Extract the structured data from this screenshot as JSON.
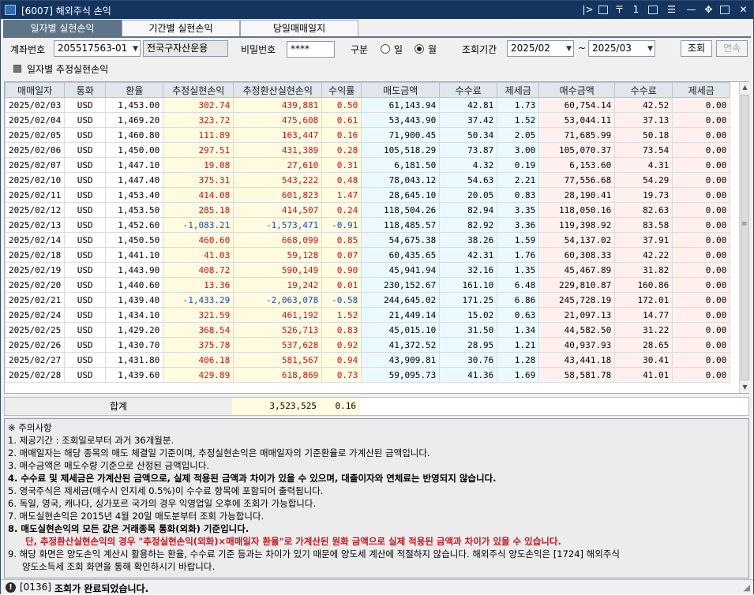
{
  "window": {
    "title": "[6007] 해외주식 손익"
  },
  "tabs": [
    {
      "label": "일자별 실현손익",
      "active": true
    },
    {
      "label": "기간별 실현손익",
      "active": false
    },
    {
      "label": "당일매매일지",
      "active": false
    }
  ],
  "form": {
    "account_label": "계좌번호",
    "account_value": "205517563-01",
    "account_type": "전국구자산운용",
    "password_label": "비밀번호",
    "password_value": "****",
    "division_label": "구분",
    "division_options": [
      "일",
      "월"
    ],
    "division_selected": "월",
    "period_label": "조회기간",
    "period_from": "2025/02",
    "period_sep": "~",
    "period_to": "2025/03",
    "search_button": "조회",
    "continue_button": "연속",
    "estimate_checkbox_label": "일자별 추정실현손익"
  },
  "table": {
    "columns": [
      "매매일자",
      "통화",
      "환율",
      "추정실현손익",
      "추정환산실현손익",
      "수익률",
      "매도금액",
      "수수료",
      "제세금",
      "매수금액",
      "수수료",
      "제세금"
    ],
    "rows": [
      [
        "2025/02/03",
        "USD",
        "1,453.00",
        "302.74",
        "439,881",
        "0.50",
        "61,143.94",
        "42.81",
        "1.73",
        "60,754.14",
        "42.52",
        "0.00"
      ],
      [
        "2025/02/04",
        "USD",
        "1,469.20",
        "323.72",
        "475,608",
        "0.61",
        "53,443.90",
        "37.42",
        "1.52",
        "53,044.11",
        "37.13",
        "0.00"
      ],
      [
        "2025/02/05",
        "USD",
        "1,460.80",
        "111.89",
        "163,447",
        "0.16",
        "71,900.45",
        "50.34",
        "2.05",
        "71,685.99",
        "50.18",
        "0.00"
      ],
      [
        "2025/02/06",
        "USD",
        "1,450.00",
        "297.51",
        "431,389",
        "0.28",
        "105,518.29",
        "73.87",
        "3.00",
        "105,070.37",
        "73.54",
        "0.00"
      ],
      [
        "2025/02/07",
        "USD",
        "1,447.10",
        "19.08",
        "27,610",
        "0.31",
        "6,181.50",
        "4.32",
        "0.19",
        "6,153.60",
        "4.31",
        "0.00"
      ],
      [
        "2025/02/10",
        "USD",
        "1,447.40",
        "375.31",
        "543,222",
        "0.48",
        "78,043.12",
        "54.63",
        "2.21",
        "77,556.68",
        "54.29",
        "0.00"
      ],
      [
        "2025/02/11",
        "USD",
        "1,453.40",
        "414.08",
        "601,823",
        "1.47",
        "28,645.10",
        "20.05",
        "0.83",
        "28,190.41",
        "19.73",
        "0.00"
      ],
      [
        "2025/02/12",
        "USD",
        "1,453.50",
        "285.18",
        "414,507",
        "0.24",
        "118,504.26",
        "82.94",
        "3.35",
        "118,050.16",
        "82.63",
        "0.00"
      ],
      [
        "2025/02/13",
        "USD",
        "1,452.60",
        "-1,083.21",
        "-1,573,471",
        "-0.91",
        "118,485.57",
        "82.92",
        "3.36",
        "119,398.92",
        "83.58",
        "0.00"
      ],
      [
        "2025/02/14",
        "USD",
        "1,450.50",
        "460.60",
        "668,099",
        "0.85",
        "54,675.38",
        "38.26",
        "1.59",
        "54,137.02",
        "37.91",
        "0.00"
      ],
      [
        "2025/02/18",
        "USD",
        "1,441.10",
        "41.03",
        "59,128",
        "0.07",
        "60,435.65",
        "42.31",
        "1.76",
        "60,308.33",
        "42.22",
        "0.00"
      ],
      [
        "2025/02/19",
        "USD",
        "1,443.90",
        "408.72",
        "590,149",
        "0.90",
        "45,941.94",
        "32.16",
        "1.35",
        "45,467.89",
        "31.82",
        "0.00"
      ],
      [
        "2025/02/20",
        "USD",
        "1,440.60",
        "13.36",
        "19,242",
        "0.01",
        "230,152.67",
        "161.10",
        "6.48",
        "229,810.87",
        "160.86",
        "0.00"
      ],
      [
        "2025/02/21",
        "USD",
        "1,439.40",
        "-1,433.29",
        "-2,063,078",
        "-0.58",
        "244,645.02",
        "171.25",
        "6.86",
        "245,728.19",
        "172.01",
        "0.00"
      ],
      [
        "2025/02/24",
        "USD",
        "1,434.10",
        "321.59",
        "461,192",
        "1.52",
        "21,449.14",
        "15.02",
        "0.63",
        "21,097.13",
        "14.77",
        "0.00"
      ],
      [
        "2025/02/25",
        "USD",
        "1,429.20",
        "368.54",
        "526,713",
        "0.83",
        "45,015.10",
        "31.50",
        "1.34",
        "44,582.50",
        "31.22",
        "0.00"
      ],
      [
        "2025/02/26",
        "USD",
        "1,430.70",
        "375.78",
        "537,628",
        "0.92",
        "41,372.52",
        "28.95",
        "1.21",
        "40,937.93",
        "28.65",
        "0.00"
      ],
      [
        "2025/02/27",
        "USD",
        "1,431.80",
        "406.18",
        "581,567",
        "0.94",
        "43,909.81",
        "30.76",
        "1.28",
        "43,441.18",
        "30.41",
        "0.00"
      ],
      [
        "2025/02/28",
        "USD",
        "1,439.60",
        "429.89",
        "618,869",
        "0.73",
        "59,095.73",
        "41.36",
        "1.69",
        "58,581.78",
        "41.01",
        "0.00"
      ]
    ]
  },
  "totals": {
    "label": "합계",
    "converted_total": "3,523,525",
    "return_total": "0.16"
  },
  "notes": {
    "heading": "※ 주의사항",
    "items": [
      "1. 제공기간 : 조회일로부터 과거 36개월분.",
      "2. 매매일자는 해당 종목의 매도 체결일 기준이며, 추정실현손익은 매매일자의 기준환율로 가계산된 금액입니다.",
      "3. 매수금액은 매도수량 기준으로 산정된 금액입니다.",
      "4. 수수료 및 제세금은 가계산된 금액으로, 실제 적용된 금액과 차이가 있을 수 있으며, 대출이자와 연체료는 반영되지 않습니다.",
      "5. 영국주식은 제세금(매수시 인지세 0.5%)이 수수료 항목에 포함되어 출력됩니다.",
      "6. 독일, 영국, 캐나다, 싱가포르 국가의 경우 익영업일 오후에 조회가 가능합니다.",
      "7. 매도실현손익은 2015년 4월 20일 매도분부터 조회 가능합니다.",
      "8. 매도실현손익의 모든 값은 거래종목 통화(외화) 기준입니다.",
      "단, 추정환산실현손익의 경우 \"추정실현손익(외화)×매매일자 환율\"로 가계산된 원화 금액으로 실제 적용된 금액과 차이가 있을 수 있습니다.",
      "9. 해당 화면은 양도손익 계산시 활용하는 환율, 수수료 기준 등과는 차이가 있기 때문에 양도세 계산에 적절하지 않습니다. 해외주식 양도손익은 [1724] 해외주식",
      "양도소득세 조회 화면을 통해 확인하시기 바랍니다."
    ]
  },
  "status": {
    "code": "[0136]",
    "message": "조회가 완료되었습니다."
  },
  "colors": {
    "titlebar": "#14355f",
    "active_tab": "#5e7487",
    "profit_red": "#d0131a",
    "loss_blue": "#1747c8",
    "yellow_col": "#fffbe0",
    "cyan_col": "#eaf9fd",
    "pink_col": "#fff0ed"
  },
  "icons": {
    "title_buttons": [
      "pipe-arrow-icon",
      "pin-icon",
      "number-icon",
      "capture-icon",
      "menu-icon",
      "minimize-icon",
      "move-icon",
      "maximize-icon",
      "close-icon"
    ]
  }
}
